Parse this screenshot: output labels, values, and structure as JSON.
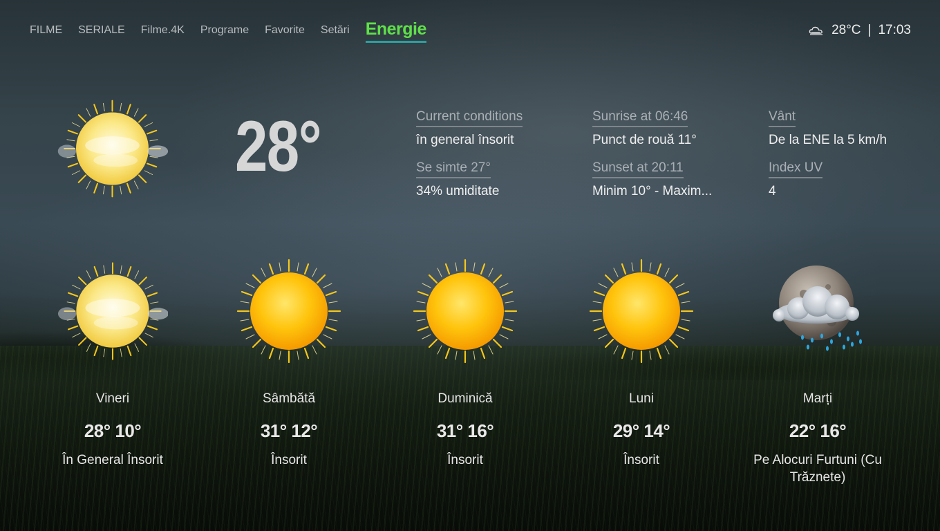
{
  "nav": {
    "items": [
      {
        "label": "FILME"
      },
      {
        "label": "SERIALE"
      },
      {
        "label": "Filme.4K"
      },
      {
        "label": "Programe"
      },
      {
        "label": "Favorite"
      },
      {
        "label": "Setări"
      },
      {
        "label": "Energie",
        "active": true
      }
    ]
  },
  "status": {
    "weather_icon": "partly-cloudy-icon",
    "temperature": "28°C",
    "separator": "|",
    "time": "17:03"
  },
  "current": {
    "icon": "partly-sunny-icon",
    "temperature": "28°",
    "details": {
      "conditions_label": "Current conditions",
      "conditions_value": "în general însorit",
      "feels_label": "Se simte 27°",
      "humidity_value": "34% umiditate",
      "sunrise_label": "Sunrise at 06:46",
      "dewpoint_value": "Punct de rouă 11°",
      "sunset_label": "Sunset at 20:11",
      "minmax_value": "Minim 10°  -  Maxim...",
      "wind_label": "Vânt",
      "wind_value": "De la ENE la 5 km/h",
      "uv_label": "Index UV",
      "uv_value": "4"
    }
  },
  "forecast": [
    {
      "day": "Vineri",
      "temps": "28° 10°",
      "condition": "În General Însorit",
      "icon": "partly-sunny-icon"
    },
    {
      "day": "Sâmbătă",
      "temps": "31° 12°",
      "condition": "Însorit",
      "icon": "sun-icon"
    },
    {
      "day": "Duminică",
      "temps": "31° 16°",
      "condition": "Însorit",
      "icon": "sun-icon"
    },
    {
      "day": "Luni",
      "temps": "29° 14°",
      "condition": "Însorit",
      "icon": "sun-icon"
    },
    {
      "day": "Marți",
      "temps": "22° 16°",
      "condition": "Pe Alocuri Furtuni (Cu Trăznete)",
      "icon": "thunderstorm-icon"
    }
  ],
  "colors": {
    "active_nav": "#5fe04a",
    "active_underline": "#2aa0a0",
    "sun_core": "#ffb300"
  }
}
